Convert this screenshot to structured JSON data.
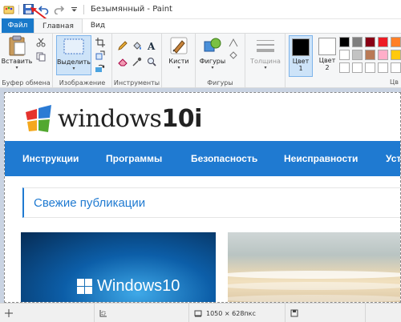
{
  "window": {
    "title": "Безымянный - Paint"
  },
  "tabs": {
    "file": "Файл",
    "home": "Главная",
    "view": "Вид"
  },
  "ribbon": {
    "clipboard": {
      "paste": "Вставить",
      "group": "Буфер обмена"
    },
    "image": {
      "select": "Выделить",
      "group": "Изображение"
    },
    "tools": {
      "group": "Инструменты"
    },
    "brushes": {
      "label": "Кисти"
    },
    "shapes": {
      "label": "Фигуры",
      "group": "Фигуры"
    },
    "size": {
      "label": "Толщина"
    },
    "color1": {
      "label": "Цвет",
      "num": "1"
    },
    "color2": {
      "label": "Цвет",
      "num": "2"
    },
    "colors_group_partial": "Цв"
  },
  "palette_colors": [
    "#000000",
    "#7f7f7f",
    "#880015",
    "#ed1c24",
    "#ff7f27",
    "#fff200",
    "#ffffff",
    "#c3c3c3",
    "#b97a57",
    "#ffaec9",
    "#ffc90e",
    "#efe4b0",
    "#ffffff",
    "#ffffff",
    "#ffffff",
    "#ffffff",
    "#ffffff",
    "#ffffff"
  ],
  "page": {
    "logo": {
      "word": "windows",
      "num": "10i"
    },
    "nav": [
      "Инструкции",
      "Программы",
      "Безопасность",
      "Неисправности",
      "Уста"
    ],
    "section_title": "Свежие публикации",
    "card1_text": "Windows10"
  },
  "status": {
    "dimensions": "1050 × 628пкс"
  },
  "colors": {
    "accent": "#1f7ad1",
    "file_tab": "#1979ca",
    "canvas_bg": "#c9d3e2",
    "annotation": "#e02020"
  }
}
